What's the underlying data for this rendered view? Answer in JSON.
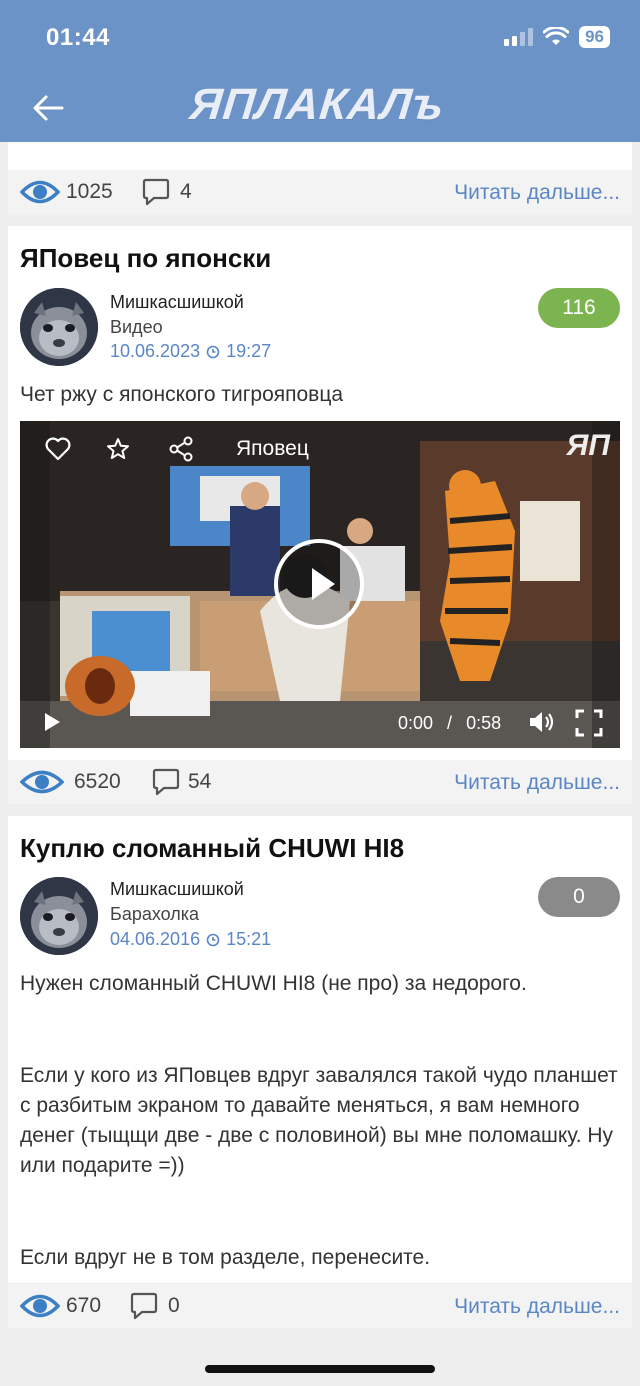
{
  "status_bar": {
    "time": "01:44",
    "battery": "96"
  },
  "header": {
    "logo": "ЯПЛАКАЛъ"
  },
  "posts": [
    {
      "views": "1025",
      "comments": "4",
      "read_more": "Читать дальше..."
    },
    {
      "title": "ЯПовец по японски",
      "author": "Мишкасшишкой",
      "category": "Видео",
      "date": "10.06.2023",
      "time": "19:27",
      "rating": "116",
      "rating_color": "#7cb550",
      "text": "Чет ржу с японского тигрояповца",
      "video": {
        "title": "Яповец",
        "current_time": "0:00",
        "separator": "/",
        "duration": "0:58",
        "watermark": "ЯП"
      },
      "views": "6520",
      "comments": "54",
      "read_more": "Читать дальше..."
    },
    {
      "title": "Куплю сломанный CHUWI HI8",
      "author": "Мишкасшишкой",
      "category": "Барахолка",
      "date": "04.06.2016",
      "time": "15:21",
      "rating": "0",
      "rating_color": "#8a8a8a",
      "paragraphs": [
        "Нужен сломанный CHUWI HI8 (не про) за недорого.",
        "Если у кого из ЯПовцев вдруг завалялся такой чудо планшет с разбитым экраном то давайте меняться, я вам немного денег (тыщщи две - две с половиной) вы мне поломашку. Ну или подарите =))",
        "Если вдруг не в том разделе, перенесите."
      ],
      "views": "670",
      "comments": "0",
      "read_more": "Читать дальше..."
    }
  ],
  "colors": {
    "header": "#6b93c8",
    "link": "#5a86c5",
    "eye": "#3d7fc4"
  }
}
